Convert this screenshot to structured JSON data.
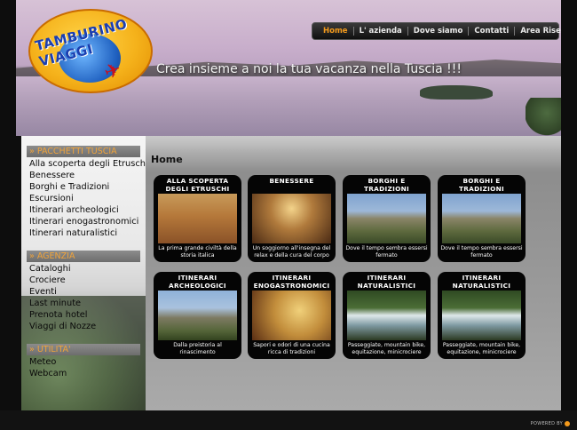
{
  "header": {
    "logo_text": "TAMBURINO VIAGGI",
    "tagline": "Crea insieme a noi la tua vacanza nella Tuscia !!!",
    "nav": [
      "Home",
      "L' azienda",
      "Dove siamo",
      "Contatti",
      "Area Riservata"
    ]
  },
  "sidebar": {
    "sections": [
      {
        "title": "» PACCHETTI TUSCIA",
        "items": [
          "Alla scoperta degli Etruschi",
          "Benessere",
          "Borghi e Tradizioni",
          "Escursioni",
          "Itinerari archeologici",
          "Itinerari enogastronomici",
          "Itinerari naturalistici"
        ]
      },
      {
        "title": "» AGENZIA",
        "items": [
          "Cataloghi",
          "Crociere",
          "Eventi",
          "Last minute",
          "Prenota hotel",
          "Viaggi di Nozze"
        ]
      },
      {
        "title": "» UTILITA'",
        "items": [
          "Meteo",
          "Webcam"
        ]
      }
    ]
  },
  "main": {
    "title": "Home",
    "cards": [
      {
        "title": "ALLA SCOPERTA\nDEGLI ETRUSCHI",
        "desc": "La prima grande civiltà della storia italica"
      },
      {
        "title": "BENESSERE",
        "desc": "Un soggiorno all'insegna del relax e della cura del corpo"
      },
      {
        "title": "BORGHI E\nTRADIZIONI",
        "desc": "Dove il tempo sembra essersi fermato"
      },
      {
        "title": "BORGHI E\nTRADIZIONI",
        "desc": "Dove il tempo sembra essersi fermato"
      },
      {
        "title": "ITINERARI\nARCHEOLOGICI",
        "desc": "Dalla preistoria al rinascimento"
      },
      {
        "title": "ITINERARI\nENOGASTRONOMICI",
        "desc": "Sapori e odori di una cucina ricca di tradizioni"
      },
      {
        "title": "ITINERARI\nNATURALISTICI",
        "desc": "Passeggiate, mountain bike, equitazione, minicrociere"
      },
      {
        "title": "ITINERARI\nNATURALISTICI",
        "desc": "Passeggiate, mountain bike, equitazione, minicrociere"
      }
    ]
  },
  "footer": {
    "powered": "POWERED BY"
  },
  "colors": {
    "accent": "#f39a1c",
    "background": "#0d0d0d",
    "card": "#050505"
  }
}
